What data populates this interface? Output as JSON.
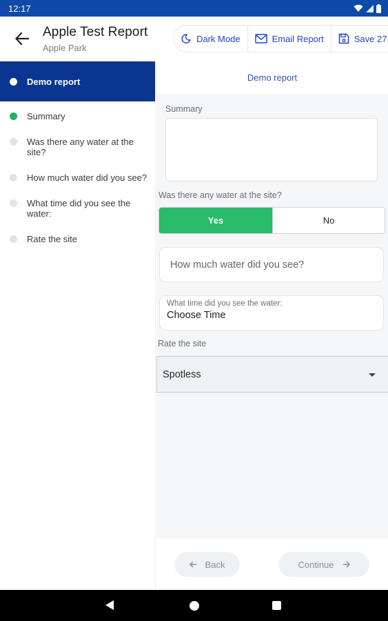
{
  "status_bar": {
    "time": "12:17"
  },
  "header": {
    "title": "Apple Test Report",
    "subtitle": "Apple Park",
    "actions": {
      "dark_mode": "Dark Mode",
      "email_report": "Email Report",
      "save": "Save 27"
    }
  },
  "sidebar": {
    "active_item": "Demo report",
    "items": [
      {
        "label": "Summary",
        "status": "complete"
      },
      {
        "label": "Was there any water at the site?",
        "status": "pending"
      },
      {
        "label": "How much water did you see?",
        "status": "pending"
      },
      {
        "label": "What time did you see the water:",
        "status": "pending"
      },
      {
        "label": "Rate the site",
        "status": "pending"
      }
    ]
  },
  "main": {
    "section_title": "Demo report",
    "summary": {
      "label": "Summary",
      "value": ""
    },
    "water_question": {
      "label": "Was there any water at the site?",
      "yes": "Yes",
      "no": "No",
      "selected": "Yes"
    },
    "water_amount": {
      "placeholder": "How much water did you see?"
    },
    "time_field": {
      "label": "What time did you see the water:",
      "value": "Choose Time"
    },
    "rating": {
      "label": "Rate the site",
      "value": "Spotless"
    },
    "footer": {
      "back": "Back",
      "continue": "Continue"
    }
  },
  "colors": {
    "status_bar": "#0e4aa8",
    "active_nav": "#0a3590",
    "accent": "#1f44c8",
    "success": "#27bb6a"
  }
}
